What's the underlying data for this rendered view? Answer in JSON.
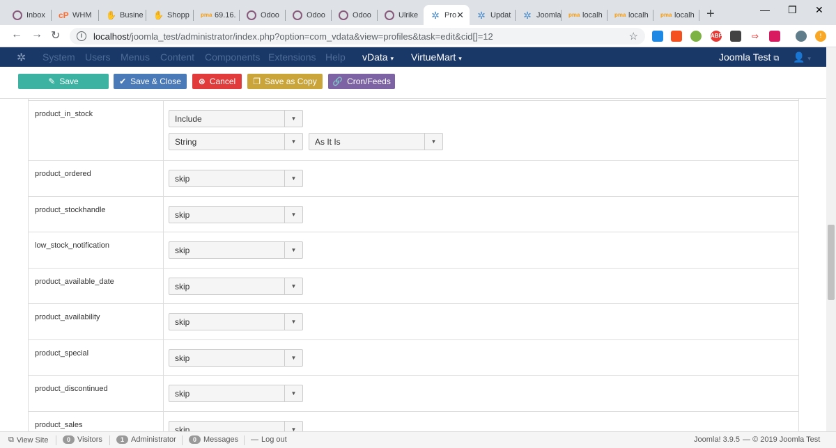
{
  "browser": {
    "tabs": [
      {
        "label": "Inbox",
        "icon": "odoo-icon"
      },
      {
        "label": "WHM",
        "icon": "cpanel-icon"
      },
      {
        "label": "Busine",
        "icon": "shop-icon"
      },
      {
        "label": "Shopp",
        "icon": "shop-icon"
      },
      {
        "label": "69.16.",
        "icon": "phpmyadmin-icon"
      },
      {
        "label": "Odoo",
        "icon": "odoo-icon"
      },
      {
        "label": "Odoo",
        "icon": "odoo-icon"
      },
      {
        "label": "Odoo",
        "icon": "odoo-icon"
      },
      {
        "label": "Ulrike",
        "icon": "odoo-icon"
      },
      {
        "label": "Pro",
        "icon": "joomla-icon"
      },
      {
        "label": "Updat",
        "icon": "joomla-icon"
      },
      {
        "label": "Joomla",
        "icon": "joomla-icon"
      },
      {
        "label": "localh",
        "icon": "phpmyadmin-icon"
      },
      {
        "label": "localh",
        "icon": "phpmyadmin-icon"
      },
      {
        "label": "localh",
        "icon": "phpmyadmin-icon"
      }
    ],
    "url_host": "localhost",
    "url_path": "/joomla_test/administrator/index.php?option=com_vdata&view=profiles&task=edit&cid[]=12"
  },
  "joomla_nav": {
    "items": [
      "System",
      "Users",
      "Menus",
      "Content",
      "Components",
      "Extensions",
      "Help"
    ],
    "vdata": "vData",
    "virtuemart": "VirtueMart",
    "site_name": "Joomla Test"
  },
  "toolbar": {
    "save": "Save",
    "save_close": "Save & Close",
    "cancel": "Cancel",
    "save_copy": "Save as Copy",
    "cron": "Cron/Feeds",
    "colors": {
      "save": "#46a546",
      "save_close": "#2f96b4"
    }
  },
  "fields": [
    {
      "name": "product_in_stock",
      "value": "Include",
      "format": "String",
      "format_option": "As It Is"
    },
    {
      "name": "product_ordered",
      "value": "skip"
    },
    {
      "name": "product_stockhandle",
      "value": "skip"
    },
    {
      "name": "low_stock_notification",
      "value": "skip"
    },
    {
      "name": "product_available_date",
      "value": "skip"
    },
    {
      "name": "product_availability",
      "value": "skip"
    },
    {
      "name": "product_special",
      "value": "skip"
    },
    {
      "name": "product_discontinued",
      "value": "skip"
    },
    {
      "name": "product_sales",
      "value": "skip"
    }
  ],
  "status": {
    "view_site": "View Site",
    "visitors_count": "0",
    "visitors": "Visitors",
    "admin_count": "1",
    "admin": "Administrator",
    "messages_count": "0",
    "messages": "Messages",
    "logout": "Log out",
    "version": "Joomla! 3.9.5",
    "copyright": "— © 2019 Joomla Test"
  }
}
